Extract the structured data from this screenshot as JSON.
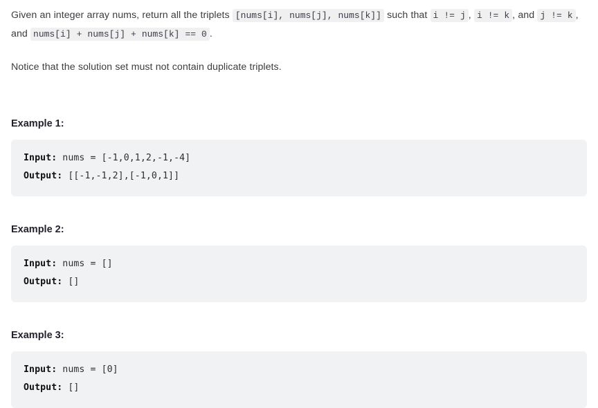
{
  "description": {
    "paragraph1": {
      "segments": [
        {
          "type": "text",
          "text": "Given an integer array nums, return all the triplets "
        },
        {
          "type": "code",
          "text": "[nums[i], nums[j], nums[k]]"
        },
        {
          "type": "text",
          "text": " such that "
        },
        {
          "type": "code",
          "text": "i != j"
        },
        {
          "type": "text",
          "text": ", "
        },
        {
          "type": "code",
          "text": "i != k"
        },
        {
          "type": "text",
          "text": ", and "
        },
        {
          "type": "code",
          "text": "j != k"
        },
        {
          "type": "text",
          "text": ", and "
        },
        {
          "type": "code",
          "text": "nums[i] + nums[j] + nums[k] == 0"
        },
        {
          "type": "text",
          "text": "."
        }
      ],
      "text_1": "Given an integer array nums, return all the triplets ",
      "code_1": "[nums[i], nums[j], nums[k]]",
      "text_2": " such that ",
      "code_2": "i != j",
      "text_3": ", ",
      "code_3": "i != k",
      "text_4": ", and ",
      "code_4": "j != k",
      "text_5": ", and ",
      "code_5": "nums[i] + nums[j] + nums[k] == 0",
      "text_6": "."
    },
    "paragraph2": "Notice that the solution set must not contain duplicate triplets."
  },
  "examples": [
    {
      "heading": "Example 1:",
      "input_label": "Input:",
      "input_value": " nums = [-1,0,1,2,-1,-4]",
      "output_label": "Output:",
      "output_value": " [[-1,-1,2],[-1,0,1]]"
    },
    {
      "heading": "Example 2:",
      "input_label": "Input:",
      "input_value": " nums = []",
      "output_label": "Output:",
      "output_value": " []"
    },
    {
      "heading": "Example 3:",
      "input_label": "Input:",
      "input_value": " nums = [0]",
      "output_label": "Output:",
      "output_value": " []"
    }
  ],
  "colors": {
    "page_background": "#ffffff",
    "body_text": "#3c3c41",
    "heading_text": "#22222c",
    "code_block_background": "#f1f2f3",
    "inline_code_background": "#f0f0f1",
    "inline_code_text": "#3b3b48",
    "code_text": "#2b2b2b"
  }
}
